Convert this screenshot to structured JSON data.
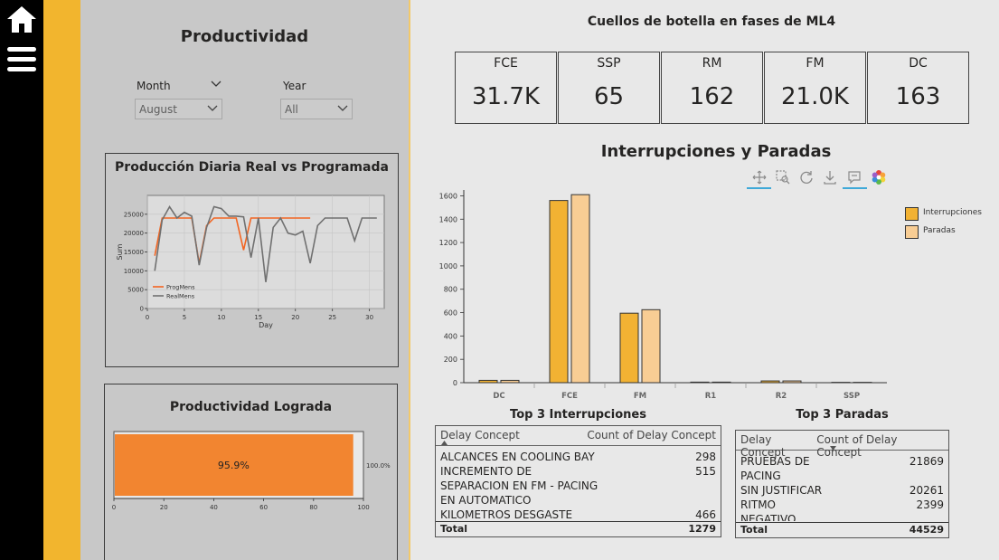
{
  "nav": {
    "home_icon": "home-icon",
    "menu_icon": "hamburger-menu-icon"
  },
  "productividad": {
    "title": "Productividad",
    "month": {
      "label": "Month",
      "value": "August"
    },
    "year": {
      "label": "Year",
      "value": "All"
    }
  },
  "daily_chart": {
    "title": "Producción Diaria Real vs Programada"
  },
  "achieved": {
    "title": "Productividad Lograda",
    "value_label": "95.9%",
    "max_label": "100.0%"
  },
  "bottleneck": {
    "title": "Cuellos de botella en fases de ML4",
    "kpis": [
      {
        "label": "FCE",
        "value": "31.7K"
      },
      {
        "label": "SSP",
        "value": "65"
      },
      {
        "label": "RM",
        "value": "162"
      },
      {
        "label": "FM",
        "value": "21.0K"
      },
      {
        "label": "DC",
        "value": "163"
      }
    ]
  },
  "interruptions_chart": {
    "title": "Interrupciones y Paradas"
  },
  "top_interrupciones": {
    "title": "Top 3 Interrupciones",
    "col1": "Delay Concept",
    "col2": "Count of Delay Concept",
    "rows": [
      {
        "concept": "ALCANCES EN COOLING BAY",
        "count": "298"
      },
      {
        "concept": "INCREMENTO DE SEPARACION EN FM - PACING EN AUTOMATICO",
        "count": "515"
      },
      {
        "concept": "KILOMETROS DESGASTE",
        "count": "466"
      }
    ],
    "total_label": "Total",
    "total_value": "1279"
  },
  "top_paradas": {
    "title": "Top 3 Paradas",
    "col1": "Delay Concept",
    "col2": "Count of Delay Concept",
    "rows": [
      {
        "concept": "PRUEBAS DE PACING",
        "count": "21869"
      },
      {
        "concept": "SIN JUSTIFICAR",
        "count": "20261"
      },
      {
        "concept": "RITMO NEGATIVO",
        "count": "2399"
      }
    ],
    "total_label": "Total",
    "total_value": "44529"
  },
  "colors": {
    "accent_yellow": "#f2b52e",
    "prog_line": "#f26522",
    "real_line": "#707070",
    "interrupciones": "#f2b233",
    "paradas": "#f8cd94",
    "gauge_fill": "#f28530"
  },
  "chart_data": [
    {
      "type": "line",
      "title": "Producción Diaria Real vs Programada",
      "xlabel": "Day",
      "ylabel": "Sum",
      "xlim": [
        0,
        32
      ],
      "ylim": [
        0,
        30000
      ],
      "x_ticks": [
        0,
        5,
        10,
        15,
        20,
        25,
        30
      ],
      "y_ticks": [
        0,
        5000,
        10000,
        15000,
        20000,
        25000
      ],
      "legend": "bottom-left",
      "grid": true,
      "series": [
        {
          "name": "ProgMens",
          "x": [
            1,
            2,
            3,
            4,
            5,
            6,
            7,
            8,
            9,
            10,
            11,
            12,
            13,
            14,
            15,
            16,
            17,
            18,
            19,
            20,
            21,
            22
          ],
          "y": [
            14000,
            24000,
            24000,
            24000,
            24000,
            24000,
            12000,
            22000,
            24000,
            24000,
            24000,
            24000,
            15500,
            24000,
            24000,
            24000,
            24000,
            24000,
            24000,
            24000,
            24000,
            24000
          ]
        },
        {
          "name": "RealMens",
          "x": [
            1,
            2,
            3,
            4,
            5,
            6,
            7,
            8,
            9,
            10,
            11,
            12,
            13,
            14,
            15,
            16,
            17,
            18,
            19,
            20,
            21,
            22,
            23,
            24,
            25,
            26,
            27,
            28,
            29,
            30,
            31
          ],
          "y": [
            10000,
            23500,
            27000,
            24000,
            25500,
            24500,
            11500,
            21500,
            27000,
            26500,
            24500,
            24500,
            24300,
            13500,
            24000,
            7000,
            21500,
            24000,
            20000,
            19500,
            20500,
            12000,
            22000,
            24000,
            24000,
            24000,
            24000,
            18000,
            24000,
            24000,
            24000
          ]
        }
      ]
    },
    {
      "type": "bar",
      "title": "Productividad Lograda",
      "categories": [
        ""
      ],
      "values": [
        95.9
      ],
      "xlim": [
        0,
        100
      ],
      "x_ticks": [
        0,
        20,
        40,
        60,
        80,
        100
      ],
      "orientation": "horizontal"
    },
    {
      "type": "bar",
      "title": "Interrupciones y Paradas",
      "categories": [
        "DC",
        "FCE",
        "FM",
        "R1",
        "R2",
        "SSP"
      ],
      "ylim": [
        0,
        1650
      ],
      "y_ticks": [
        0,
        200,
        400,
        600,
        800,
        1000,
        1200,
        1400,
        1600
      ],
      "legend": "top-right",
      "series": [
        {
          "name": "Interrupciones",
          "values": [
            20,
            1560,
            595,
            5,
            15,
            3
          ]
        },
        {
          "name": "Paradas",
          "values": [
            20,
            1610,
            625,
            5,
            15,
            3
          ]
        }
      ]
    }
  ]
}
